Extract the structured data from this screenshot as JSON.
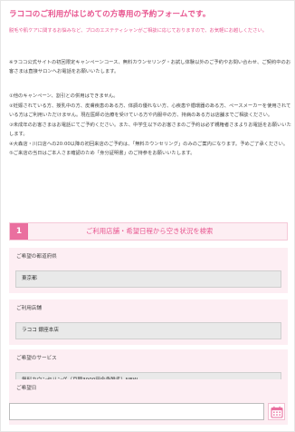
{
  "title": "ラココのご利用がはじめての方専用の予約フォームです。",
  "intro": "脱毛や肌ケアに関するお悩みなど、プロのエステティシャンがご相談に応じておりますので、お気軽にお越しください。",
  "note": "※ラココ公式サイトの初回限定キャンペーンコース、無料カウンセリング・お試し体験以外のご予約やお問い合わせ、ご契約中のお客さまは直接サロンへお電話をお願いいたします。",
  "rules": [
    "①他のキャンペーン、割引との併用はできません。",
    "②妊娠されている方、授乳中の方、皮膚疾患のある方、体調の優れない方、心疾患や循環器のある方、ペースメーカーを使用されている方はご利用いただけません。現在医師の治療を受けている方や内服中の方、持病のある方は店舗までご相談ください。",
    "③未成年のお客さまはお電話にてご予約ください。また、中学生以下のお客さまのご予約は必ず親権者さまよりお電話をお願いいたします。",
    "④大森店・川口店への20:00以降の初回来店のご予約は、「無料カウンセリング」のみのご案内になります。予めご了承ください。",
    "⑤ご来店の当日はご本人さま確認のため「身分証明書」のご持参をお願いいたします。"
  ],
  "step": {
    "number": "1",
    "title": "ご利用店舗・希望日程から空き状況を検索"
  },
  "sections": {
    "prefecture": {
      "label": "ご希望の都道府県",
      "value": "東京都"
    },
    "store": {
      "label": "ご利用店舗",
      "value": "ラココ 銀座本店"
    },
    "service": {
      "label": "ご希望のサービス",
      "value": "無料カウンセリング（月額3000円全身脱毛）NEW"
    },
    "date": {
      "label": "ご希望日",
      "value": ""
    }
  },
  "icons": {
    "calendar": "calendar-icon"
  },
  "colors": {
    "accent": "#e8558f",
    "accent_strong": "#ea6f9f",
    "panel_bg": "#fdeef3"
  }
}
